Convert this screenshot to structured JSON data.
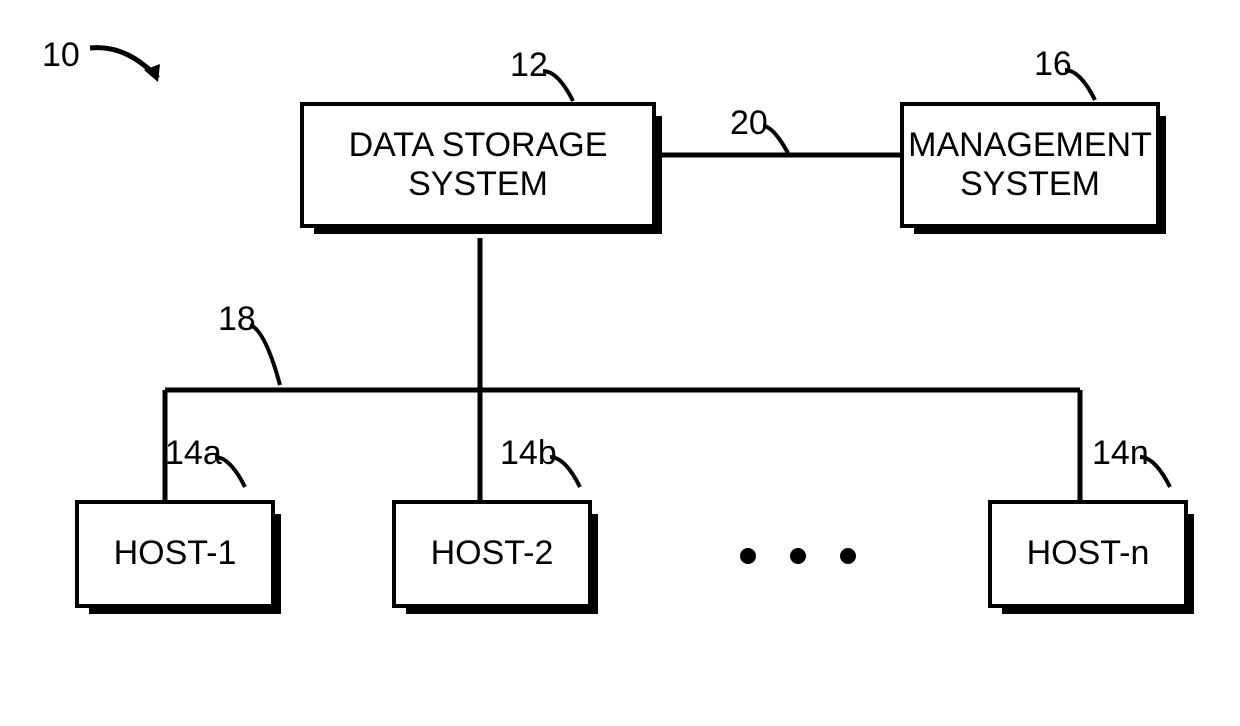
{
  "diagram_ref": "10",
  "boxes": {
    "data_storage": {
      "ref": "12",
      "label": "DATA STORAGE\nSYSTEM"
    },
    "management": {
      "ref": "16",
      "label": "MANAGEMENT\nSYSTEM"
    },
    "host1": {
      "ref": "14a",
      "label": "HOST-1"
    },
    "host2": {
      "ref": "14b",
      "label": "HOST-2"
    },
    "hostn": {
      "ref": "14n",
      "label": "HOST-n"
    }
  },
  "links": {
    "hosts_bus": {
      "ref": "18"
    },
    "mgmt_link": {
      "ref": "20"
    }
  },
  "ellipsis": "• • •"
}
